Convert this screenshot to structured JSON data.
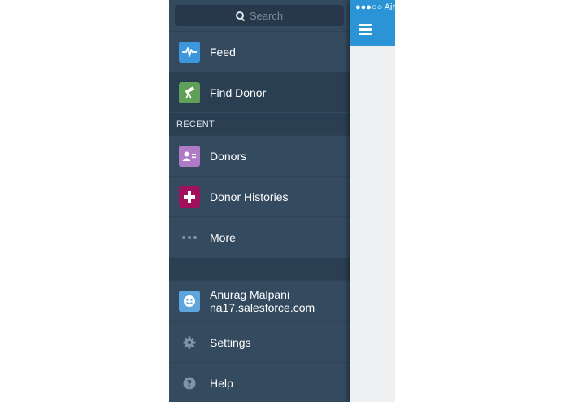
{
  "status_bar": {
    "carrier": "●●●○○ Airt"
  },
  "search": {
    "placeholder": "Search"
  },
  "menu": {
    "items": [
      {
        "label": "Feed",
        "icon": "pulse-icon",
        "color": "#3c97dd"
      },
      {
        "label": "Find Donor",
        "icon": "telescope-icon",
        "color": "#5f9f58",
        "active": true
      }
    ],
    "recent_header": "RECENT",
    "recent_items": [
      {
        "label": "Donors",
        "icon": "contact-card-icon",
        "color": "#b07bc6"
      },
      {
        "label": "Donor Histories",
        "icon": "plus-icon",
        "color": "#a1115b"
      },
      {
        "label": "More",
        "icon": "more-dots-icon"
      }
    ],
    "user": {
      "name": "Anurag Malpani",
      "domain": "na17.salesforce.com",
      "icon": "smiley-icon",
      "color": "#5ea5dc"
    },
    "settings_label": "Settings",
    "help_label": "Help"
  },
  "colors": {
    "menu_bg": "#344a5f",
    "header_blue": "#2a94d6",
    "active_bg": "#2b3f52"
  }
}
